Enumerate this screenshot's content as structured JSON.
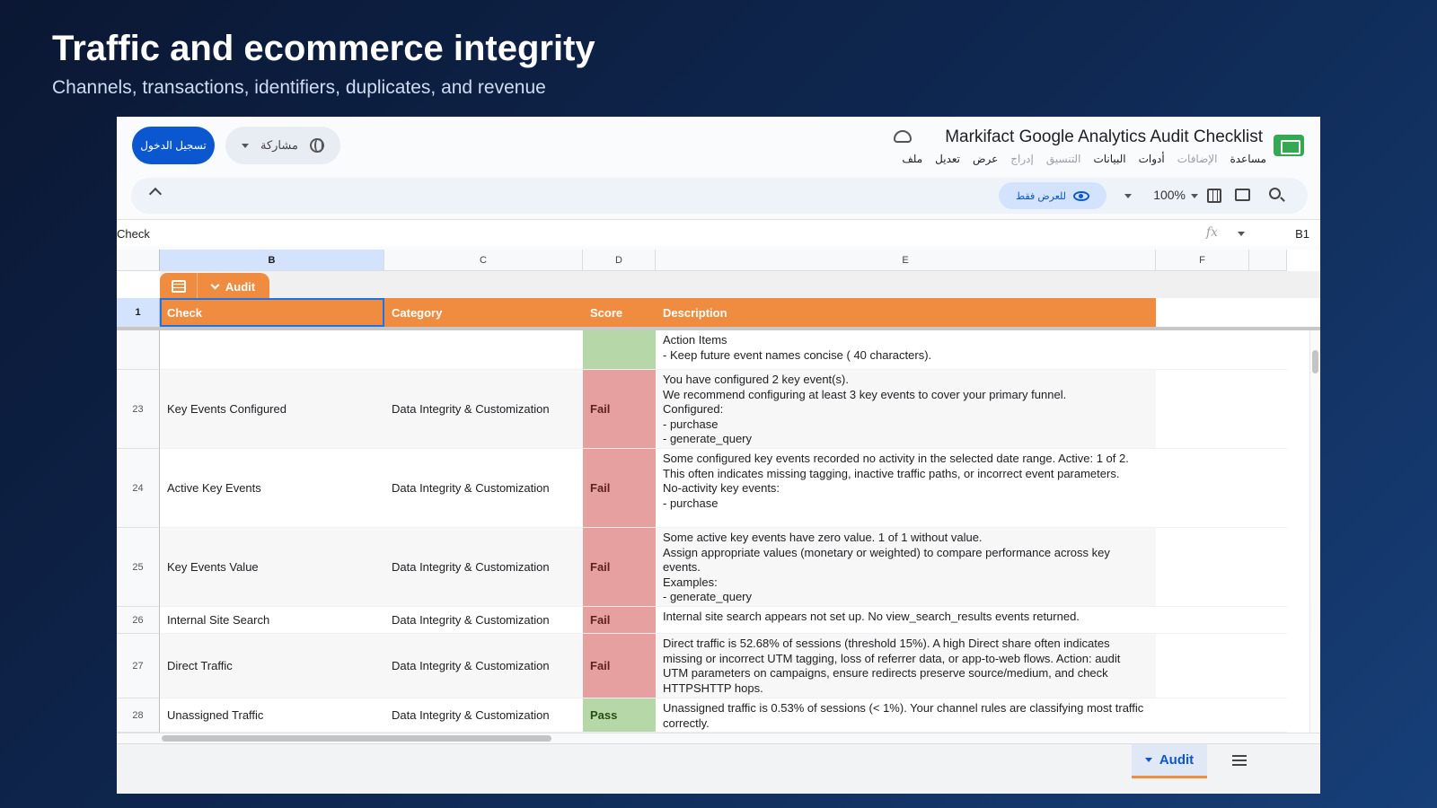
{
  "slide": {
    "title": "Traffic and ecommerce integrity",
    "subtitle": "Channels, transactions, identifiers, duplicates, and revenue"
  },
  "header": {
    "doc_title": "Markifact Google Analytics Audit Checklist",
    "signin_label": "تسجيل الدخول",
    "share_label": "مشاركة",
    "menu": [
      "ملف",
      "تعديل",
      "عرض",
      "إدراج",
      "التنسيق",
      "البيانات",
      "أدوات",
      "الإضافات",
      "مساعدة"
    ],
    "menu_dim": [
      false,
      false,
      false,
      true,
      true,
      false,
      false,
      true,
      false
    ]
  },
  "toolbar": {
    "view_only_label": "للعرض فقط",
    "zoom": "100%"
  },
  "formula_bar": {
    "cell_ref": "B1",
    "content": "Check",
    "fx_label": "fx"
  },
  "grid": {
    "columns": [
      "B",
      "C",
      "D",
      "E",
      "F"
    ],
    "selected_column": "B",
    "table_name": "Audit",
    "headers": [
      "Check",
      "Category",
      "Score",
      "Description"
    ],
    "header_row_number": "1",
    "rows": [
      {
        "num": "",
        "check": "",
        "category": "",
        "score": "",
        "status": "blank",
        "description": "Action Items\n- Keep future event names concise ( 40 characters)."
      },
      {
        "num": "23",
        "check": "Key Events Configured",
        "category": "Data Integrity & Customization",
        "score": "Fail",
        "status": "fail",
        "description": "You have configured 2 key event(s).\nWe recommend configuring at least 3 key events to cover your primary funnel.\nConfigured:\n- purchase\n- generate_query"
      },
      {
        "num": "24",
        "check": "Active Key Events",
        "category": "Data Integrity & Customization",
        "score": "Fail",
        "status": "fail",
        "description": "Some configured key events recorded no activity in the selected date range. Active: 1 of 2.\nThis often indicates missing tagging, inactive traffic paths, or incorrect event parameters.\nNo-activity key events:\n- purchase"
      },
      {
        "num": "25",
        "check": "Key Events Value",
        "category": "Data Integrity & Customization",
        "score": "Fail",
        "status": "fail",
        "description": "Some active key events have zero value. 1 of 1 without value.\nAssign appropriate values (monetary or weighted) to compare performance across key events.\nExamples:\n- generate_query"
      },
      {
        "num": "26",
        "check": "Internal Site Search",
        "category": "Data Integrity & Customization",
        "score": "Fail",
        "status": "fail",
        "description": "Internal site search appears not set up. No view_search_results events returned."
      },
      {
        "num": "27",
        "check": "Direct Traffic",
        "category": "Data Integrity & Customization",
        "score": "Fail",
        "status": "fail",
        "description": "Direct traffic is 52.68% of sessions (threshold 15%). A high Direct share often indicates missing or incorrect UTM tagging, loss of referrer data, or app-to-web flows. Action: audit UTM parameters on campaigns, ensure redirects preserve source/medium, and check HTTPSHTTP hops."
      },
      {
        "num": "28",
        "check": "Unassigned Traffic",
        "category": "Data Integrity & Customization",
        "score": "Pass",
        "status": "pass",
        "description": "Unassigned traffic is 0.53% of sessions (< 1%). Your channel rules are classifying most traffic correctly."
      }
    ]
  },
  "bottom_bar": {
    "sheet_tab": "Audit"
  },
  "colors": {
    "accent_orange": "#ef8c3f",
    "fail": "#e6a0a0",
    "pass": "#b6d7a8",
    "primary_blue": "#0b57d0"
  }
}
